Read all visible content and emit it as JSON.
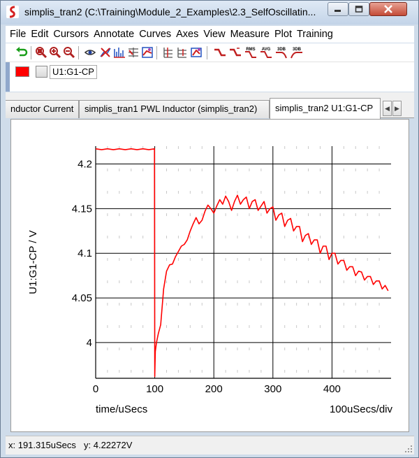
{
  "window": {
    "title": "simplis_tran2 (C:\\Training\\Module_2_Examples\\2.3_SelfOscillatin..."
  },
  "menu": {
    "items": [
      "File",
      "Edit",
      "Cursors",
      "Annotate",
      "Curves",
      "Axes",
      "View",
      "Measure",
      "Plot",
      "Training"
    ]
  },
  "toolbar": {
    "icons": [
      "undo-icon",
      "zoom-fit-icon",
      "zoom-in-icon",
      "zoom-out-icon",
      "view-eye-icon",
      "delete-curve-icon",
      "fourier-icon",
      "grid-add-icon",
      "combine-icon",
      "stack-grid-icon",
      "split-grid-icon",
      "axis-tool-icon",
      "measure-rise-icon",
      "measure-fall-icon",
      "rms-icon",
      "avg-icon",
      "3db-high-icon",
      "3db-low-icon"
    ],
    "text_labels": {
      "rms": "RMS",
      "avg": "AVG",
      "db1": "3DB",
      "db2": "3DB"
    }
  },
  "legend": {
    "curve_label": "U1:G1-CP",
    "curve_color": "#ff0000"
  },
  "tabs": [
    {
      "label": "nductor Current",
      "active": false
    },
    {
      "label": "simplis_tran1 PWL Inductor (simplis_tran2)",
      "active": false
    },
    {
      "label": "simplis_tran2 U1:G1-CP",
      "active": true
    }
  ],
  "chart_data": {
    "type": "line",
    "xlabel": "time/uSecs",
    "ylabel": "U1:G1-CP / V",
    "x_scale_label": "100uSecs/div",
    "xlim": [
      0,
      500
    ],
    "ylim": [
      3.96,
      4.22
    ],
    "x_ticks": [
      0,
      100,
      200,
      300,
      400
    ],
    "x_tick_labels": [
      "0",
      "100",
      "200",
      "300",
      "400"
    ],
    "y_ticks": [
      4.0,
      4.05,
      4.1,
      4.15,
      4.2
    ],
    "y_tick_labels": [
      "4",
      "4.05",
      "4.1",
      "4.15",
      "4.2"
    ],
    "grid": true,
    "series": [
      {
        "color": "#ff0000",
        "x": [
          0,
          10,
          20,
          30,
          40,
          50,
          60,
          70,
          80,
          90,
          99.5,
          100,
          101,
          103,
          106,
          110,
          115,
          120,
          125,
          130,
          135,
          140,
          145,
          150,
          155,
          160,
          165,
          170,
          175,
          180,
          185,
          190,
          195,
          200,
          205,
          210,
          215,
          220,
          225,
          230,
          235,
          240,
          245,
          250,
          255,
          260,
          265,
          270,
          275,
          280,
          285,
          290,
          295,
          300,
          305,
          310,
          315,
          320,
          325,
          330,
          335,
          340,
          345,
          350,
          355,
          360,
          365,
          370,
          375,
          380,
          385,
          390,
          395,
          400,
          405,
          410,
          415,
          420,
          425,
          430,
          435,
          440,
          445,
          450,
          455,
          460,
          465,
          470,
          475,
          480,
          485,
          490,
          495
        ],
        "y": [
          4.217,
          4.216,
          4.217,
          4.216,
          4.217,
          4.216,
          4.217,
          4.216,
          4.217,
          4.216,
          4.217,
          3.962,
          3.99,
          4.0,
          4.01,
          4.02,
          4.06,
          4.08,
          4.087,
          4.088,
          4.096,
          4.102,
          4.108,
          4.11,
          4.115,
          4.125,
          4.133,
          4.14,
          4.133,
          4.137,
          4.147,
          4.154,
          4.15,
          4.145,
          4.153,
          4.16,
          4.155,
          4.164,
          4.158,
          4.148,
          4.158,
          4.165,
          4.155,
          4.16,
          4.163,
          4.15,
          4.158,
          4.16,
          4.148,
          4.153,
          4.158,
          4.145,
          4.15,
          4.152,
          4.137,
          4.143,
          4.145,
          4.13,
          4.137,
          4.139,
          4.125,
          4.13,
          4.13,
          4.113,
          4.12,
          4.122,
          4.11,
          4.115,
          4.115,
          4.1,
          4.108,
          4.108,
          4.093,
          4.1,
          4.1,
          4.088,
          4.092,
          4.092,
          4.081,
          4.085,
          4.085,
          4.075,
          4.08,
          4.079,
          4.07,
          4.074,
          4.074,
          4.065,
          4.069,
          4.069,
          4.06,
          4.064,
          4.058
        ]
      }
    ]
  },
  "status": {
    "x_readout": "x: 191.315uSecs",
    "y_readout": "y: 4.22272V"
  }
}
